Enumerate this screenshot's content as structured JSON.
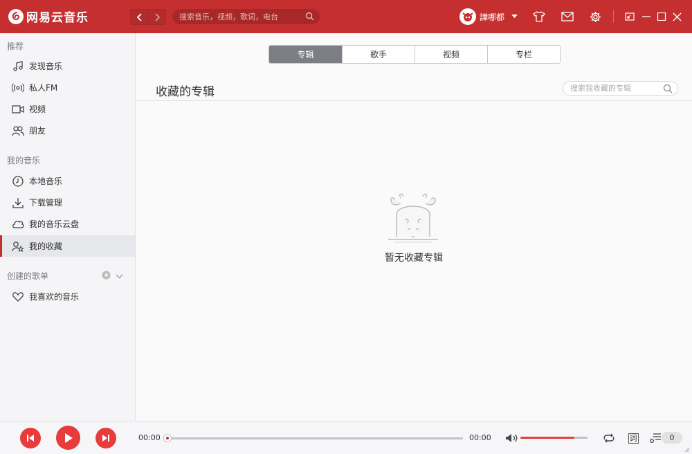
{
  "app": {
    "name": "网易云音乐",
    "search_placeholder": "搜索音乐，视频，歌词，电台",
    "username": "譁哪都",
    "brand_color": "#c62f2f"
  },
  "sidebar": {
    "recommend_title": "推荐",
    "recommend_items": [
      {
        "label": "发现音乐",
        "icon": "music-note-icon"
      },
      {
        "label": "私人FM",
        "icon": "radio-icon"
      },
      {
        "label": "视频",
        "icon": "video-icon"
      },
      {
        "label": "朋友",
        "icon": "friends-icon"
      }
    ],
    "my_music_title": "我的音乐",
    "my_music_items": [
      {
        "label": "本地音乐",
        "icon": "local-music-icon"
      },
      {
        "label": "下载管理",
        "icon": "download-icon"
      },
      {
        "label": "我的音乐云盘",
        "icon": "cloud-icon"
      },
      {
        "label": "我的收藏",
        "icon": "collection-icon",
        "active": true
      }
    ],
    "playlists_title": "创建的歌单",
    "playlist_items": [
      {
        "label": "我喜欢的音乐",
        "icon": "heart-icon"
      }
    ]
  },
  "main": {
    "tabs": [
      {
        "label": "专辑",
        "active": true
      },
      {
        "label": "歌手"
      },
      {
        "label": "视频"
      },
      {
        "label": "专栏"
      }
    ],
    "title": "收藏的专辑",
    "search_placeholder": "搜索我收藏的专辑",
    "empty_text": "暂无收藏专辑"
  },
  "player": {
    "current_time": "00:00",
    "total_time": "00:00",
    "progress": 0,
    "volume": 0.8,
    "lyric_label": "词",
    "playlist_count": "0"
  }
}
